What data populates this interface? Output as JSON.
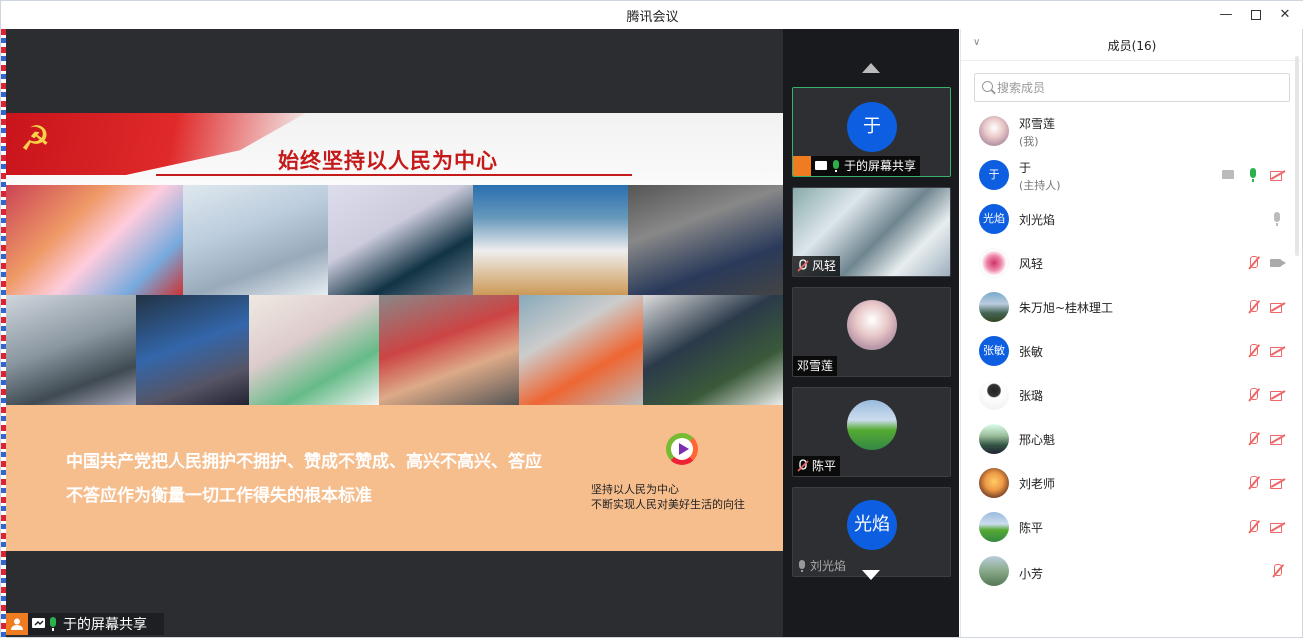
{
  "window": {
    "title": "腾讯会议"
  },
  "slide": {
    "title": "始终坚持以人民为中心",
    "band_line1": "中国共产党把人民拥护不拥护、赞成不赞成、高兴不高兴、答应",
    "band_line2": "不答应作为衡量一切工作得失的根本标准",
    "slogan_line1": "坚持以人民为中心",
    "slogan_line2": "不断实现人民对美好生活的向往"
  },
  "share_badge": {
    "label": "于的屏幕共享"
  },
  "video_tiles": [
    {
      "label": "于的屏幕共享",
      "avatar_text": "于",
      "state": "active"
    },
    {
      "label": "风轻"
    },
    {
      "label": "邓雪莲"
    },
    {
      "label": "陈平"
    },
    {
      "label": "刘光焰",
      "avatar_text": "光焰"
    }
  ],
  "panel": {
    "title": "成员(16)",
    "search_placeholder": "搜索成员",
    "members": [
      {
        "name": "邓雪莲",
        "sub": "(我)"
      },
      {
        "name": "于",
        "sub": "(主持人)",
        "avatar_text": "于"
      },
      {
        "name": "刘光焰",
        "avatar_text": "光焰"
      },
      {
        "name": "风轻"
      },
      {
        "name": "朱万旭~桂林理工"
      },
      {
        "name": "张敏",
        "avatar_text": "张敏"
      },
      {
        "name": "张璐"
      },
      {
        "name": "邢心魁"
      },
      {
        "name": "刘老师"
      },
      {
        "name": "陈平"
      },
      {
        "name": "小芳"
      }
    ]
  },
  "colors": {
    "accent": "#0d5ee0",
    "mic_on": "#2bb24c",
    "muted": "#e66666",
    "share_icon": "#f07c22"
  }
}
